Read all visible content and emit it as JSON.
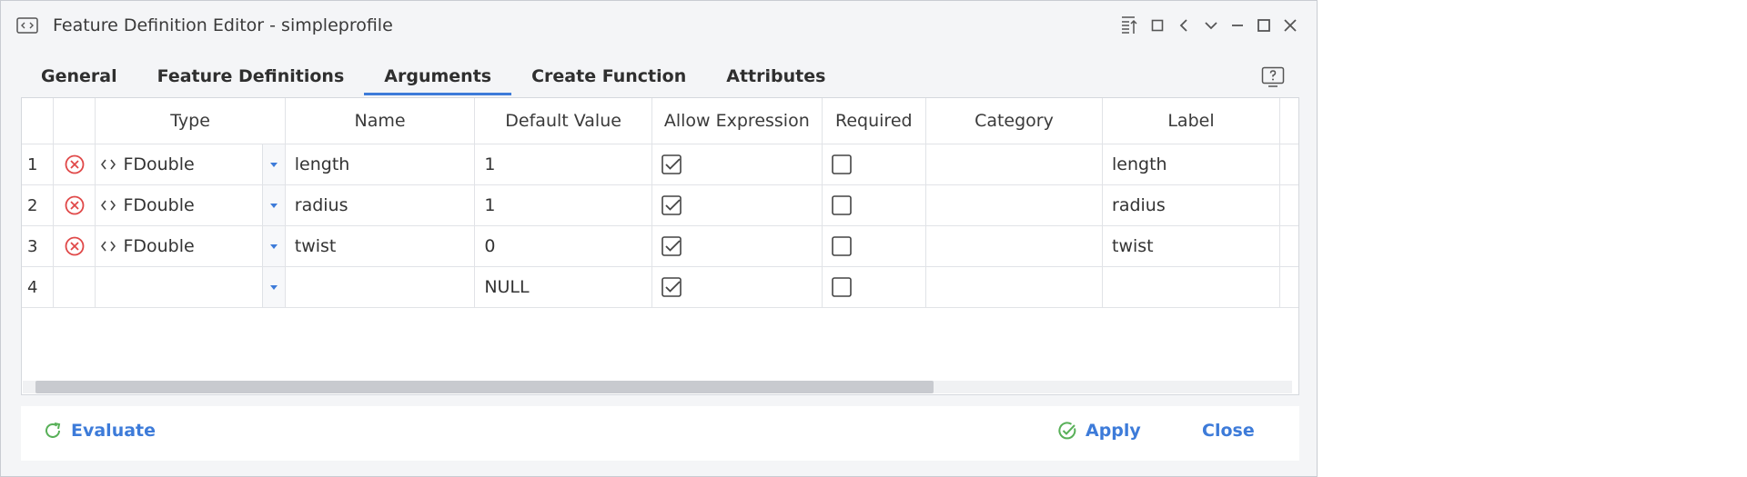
{
  "window": {
    "title": "Feature Definition Editor - simpleprofile"
  },
  "tabs": [
    {
      "label": "General"
    },
    {
      "label": "Feature Definitions"
    },
    {
      "label": "Arguments"
    },
    {
      "label": "Create Function"
    },
    {
      "label": "Attributes"
    }
  ],
  "active_tab": "Arguments",
  "table": {
    "columns": [
      "Type",
      "Name",
      "Default Value",
      "Allow Expression",
      "Required",
      "Category",
      "Label"
    ],
    "rows": [
      {
        "num": "1",
        "type": "FDouble",
        "name": "length",
        "default": "1",
        "allow_expression": true,
        "required": false,
        "category": "",
        "label": "length"
      },
      {
        "num": "2",
        "type": "FDouble",
        "name": "radius",
        "default": "1",
        "allow_expression": true,
        "required": false,
        "category": "",
        "label": "radius"
      },
      {
        "num": "3",
        "type": "FDouble",
        "name": "twist",
        "default": "0",
        "allow_expression": true,
        "required": false,
        "category": "",
        "label": "twist"
      },
      {
        "num": "4",
        "type": "",
        "name": "",
        "default": "NULL",
        "allow_expression": true,
        "required": false,
        "category": "",
        "label": ""
      }
    ]
  },
  "footer": {
    "evaluate": "Evaluate",
    "apply": "Apply",
    "close": "Close"
  },
  "colors": {
    "accent": "#3d7bd9",
    "delete": "#e04848",
    "apply_check": "#58b058"
  }
}
